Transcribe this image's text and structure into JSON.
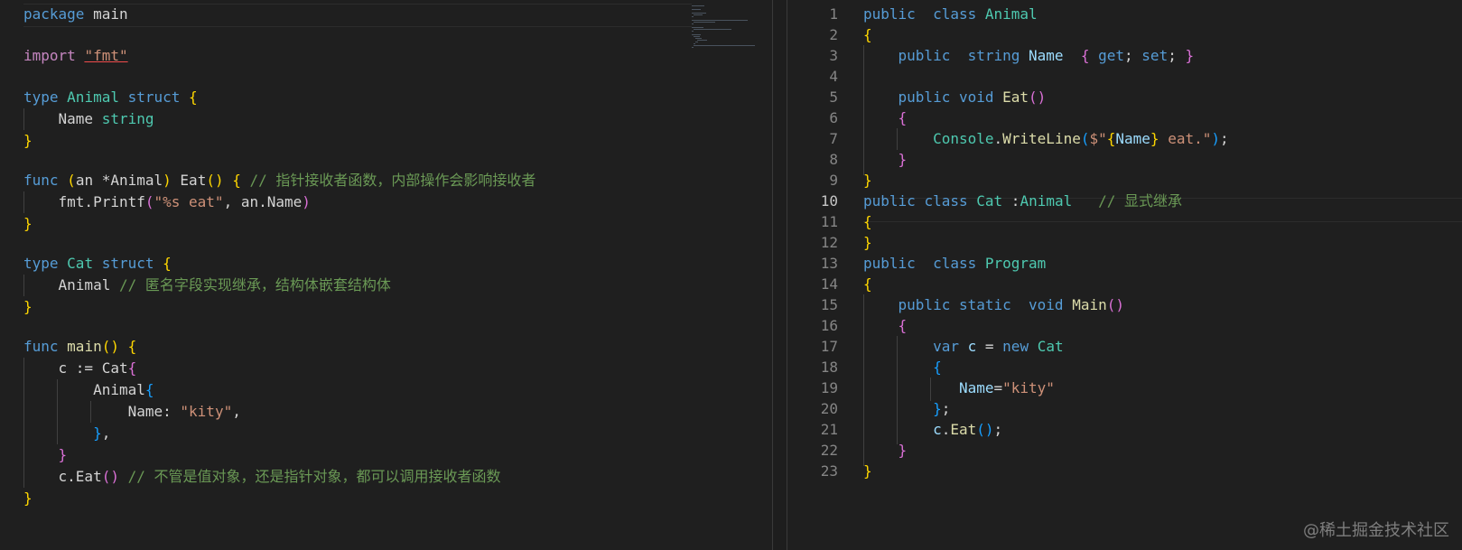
{
  "left_editor": {
    "lines": [
      "package main",
      "",
      "import \"fmt\"",
      "",
      "type Animal struct {",
      "    Name string",
      "}",
      "",
      "func (an *Animal) Eat() { // 指针接收者函数，内部操作会影响接收者",
      "    fmt.Printf(\"%s eat\", an.Name)",
      "}",
      "",
      "type Cat struct {",
      "    Animal // 匿名字段实现继承，结构体嵌套结构体",
      "}",
      "",
      "func main() {",
      "    c := Cat{",
      "        Animal{",
      "            Name: \"kity\",",
      "        },",
      "    }",
      "    c.Eat() // 不管是值对象，还是指针对象，都可以调用接收者函数",
      "}"
    ]
  },
  "right_editor": {
    "line_numbers": [
      "1",
      "2",
      "3",
      "4",
      "5",
      "6",
      "7",
      "8",
      "9",
      "10",
      "11",
      "12",
      "13",
      "14",
      "15",
      "16",
      "17",
      "18",
      "19",
      "20",
      "21",
      "22",
      "23"
    ],
    "active_line": "10",
    "lines": [
      "public  class Animal",
      "{",
      "    public  string Name  { get; set; }",
      "",
      "    public void Eat()",
      "    {",
      "        Console.WriteLine($\"{Name} eat.\");",
      "    }",
      "}",
      "public class Cat :Animal   // 显式继承",
      "{",
      "}",
      "public  class Program",
      "{",
      "    public static  void Main()",
      "    {",
      "        var c = new Cat",
      "        {",
      "           Name=\"kity\"",
      "        };",
      "        c.Eat();",
      "    }",
      "}"
    ]
  },
  "watermark": "@稀土掘金技术社区",
  "colors": {
    "background": "#1f1f1f",
    "keyword": "#569cd6",
    "control_keyword": "#c586c0",
    "type": "#4ec9b0",
    "function": "#dcdcaa",
    "string": "#ce9178",
    "comment": "#6a9955",
    "property": "#9cdcfe",
    "bracket_level_1": "#ffd700",
    "bracket_level_2": "#da70d6",
    "bracket_level_3": "#179fff",
    "line_number": "#858585"
  }
}
